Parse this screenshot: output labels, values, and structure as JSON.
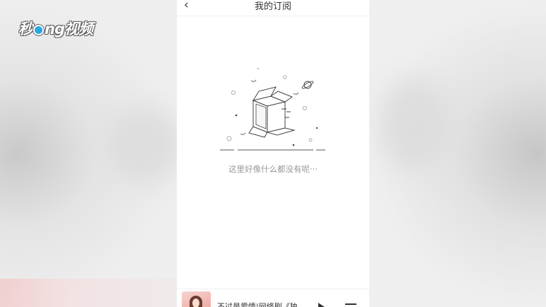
{
  "watermark": {
    "logo_text_a": "秒",
    "logo_text_b": "ng视频"
  },
  "header": {
    "back_icon": "chevron-left-icon",
    "title": "我的订阅"
  },
  "empty_state": {
    "illustration": "empty-box-icon",
    "message": "这里好像什么都没有呢···"
  },
  "mini_player": {
    "song_title": "不过是爱情|网络剧《独…",
    "play_icon": "play-icon",
    "playlist_icon": "playlist-icon"
  },
  "colors": {
    "screen_bg": "#ffffff",
    "text_primary": "#333333",
    "text_muted": "#9a9a9a",
    "logo_accent": "#2aa7e0"
  }
}
